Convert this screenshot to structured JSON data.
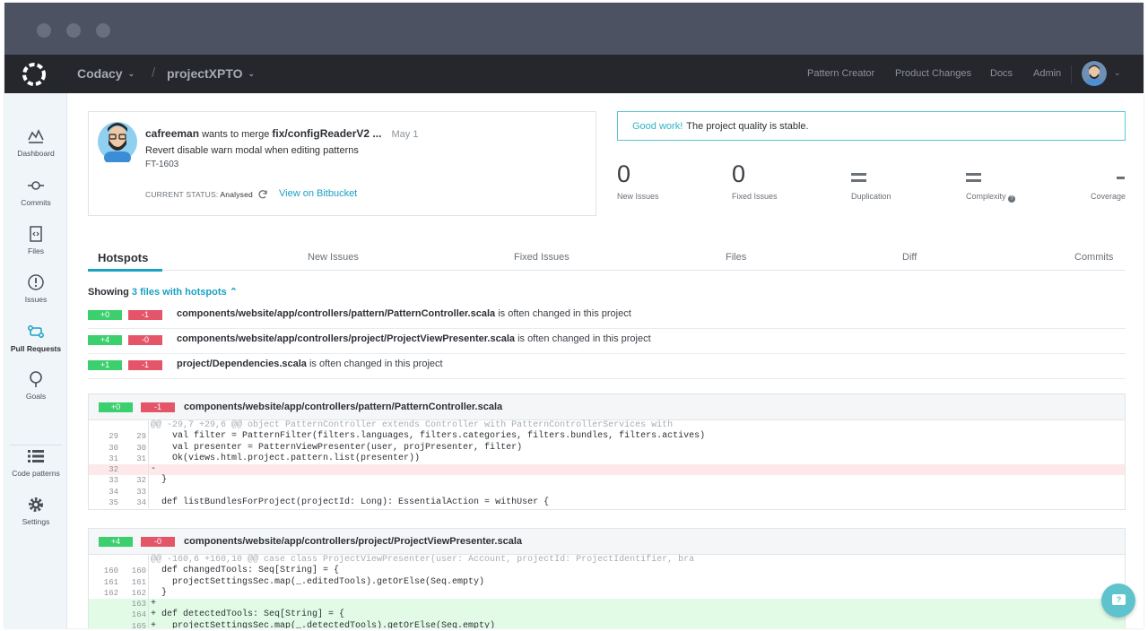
{
  "nav": {
    "org": "Codacy",
    "project": "projectXPTO",
    "links": [
      "Pattern Creator",
      "Product Changes",
      "Docs",
      "Admin"
    ]
  },
  "sidebar": {
    "items": [
      {
        "label": "Dashboard",
        "icon": "dashboard-icon"
      },
      {
        "label": "Commits",
        "icon": "commit-icon"
      },
      {
        "label": "Files",
        "icon": "file-icon"
      },
      {
        "label": "Issues",
        "icon": "alert-icon"
      },
      {
        "label": "Pull Requests",
        "icon": "pull-request-icon"
      },
      {
        "label": "Goals",
        "icon": "goals-icon"
      },
      {
        "label": "Code patterns",
        "icon": "list-icon"
      },
      {
        "label": "Settings",
        "icon": "gear-icon"
      }
    ]
  },
  "pr": {
    "author": "cafreeman",
    "action": "wants to merge",
    "branch": "fix/configReaderV2 ...",
    "date": "May 1",
    "title": "Revert disable warn modal when editing patterns",
    "code": "FT-1603",
    "status_label": "CURRENT STATUS:",
    "status_value": "Analysed",
    "link": "View on Bitbucket"
  },
  "quality": {
    "good": "Good work!",
    "message": "The project quality is stable."
  },
  "metrics": [
    {
      "value": "0",
      "label": "New Issues"
    },
    {
      "value": "0",
      "label": "Fixed Issues"
    },
    {
      "value": "=",
      "label": "Duplication"
    },
    {
      "value": "=",
      "label": "Complexity"
    },
    {
      "value": "-",
      "label": "Coverage"
    }
  ],
  "tabs": [
    "Hotspots",
    "New Issues",
    "Fixed Issues",
    "Files",
    "Diff",
    "Commits"
  ],
  "showing": {
    "prefix": "Showing",
    "link": "3 files with hotspots"
  },
  "hotspots": [
    {
      "add": "+0",
      "del": "-1",
      "file": "components/website/app/controllers/pattern/PatternController.scala",
      "suffix": "is often changed in this project"
    },
    {
      "add": "+4",
      "del": "-0",
      "file": "components/website/app/controllers/project/ProjectViewPresenter.scala",
      "suffix": "is often changed in this project"
    },
    {
      "add": "+1",
      "del": "-1",
      "file": "project/Dependencies.scala",
      "suffix": "is often changed in this project"
    }
  ],
  "diffs": [
    {
      "add": "+0",
      "del": "-1",
      "file": "components/website/app/controllers/pattern/PatternController.scala",
      "lines": [
        {
          "a": "",
          "b": "",
          "type": "hunk",
          "code": "@@ -29,7 +29,6 @@ object PatternController extends Controller with PatternControllerServices with"
        },
        {
          "a": "29",
          "b": "29",
          "type": "ctx",
          "code": "    val filter = PatternFilter(filters.languages, filters.categories, filters.bundles, filters.actives)"
        },
        {
          "a": "30",
          "b": "30",
          "type": "ctx",
          "code": "    val presenter = PatternViewPresenter(user, projPresenter, filter)"
        },
        {
          "a": "31",
          "b": "31",
          "type": "ctx",
          "code": "    Ok(views.html.project.pattern.list(presenter))"
        },
        {
          "a": "32",
          "b": "",
          "type": "del",
          "code": "-"
        },
        {
          "a": "33",
          "b": "32",
          "type": "ctx",
          "code": "  }"
        },
        {
          "a": "34",
          "b": "33",
          "type": "ctx",
          "code": ""
        },
        {
          "a": "35",
          "b": "34",
          "type": "ctx",
          "code": "  def listBundlesForProject(projectId: Long): EssentialAction = withUser {"
        }
      ]
    },
    {
      "add": "+4",
      "del": "-0",
      "file": "components/website/app/controllers/project/ProjectViewPresenter.scala",
      "lines": [
        {
          "a": "",
          "b": "",
          "type": "hunk",
          "code": "@@ -160,6 +160,10 @@ case class ProjectViewPresenter(user: Account, projectId: ProjectIdentifier, bra"
        },
        {
          "a": "160",
          "b": "160",
          "type": "ctx",
          "code": "  def changedTools: Seq[String] = {"
        },
        {
          "a": "161",
          "b": "161",
          "type": "ctx",
          "code": "    projectSettingsSec.map(_.editedTools).getOrElse(Seq.empty)"
        },
        {
          "a": "162",
          "b": "162",
          "type": "ctx",
          "code": "  }"
        },
        {
          "a": "",
          "b": "163",
          "type": "add",
          "code": "+"
        },
        {
          "a": "",
          "b": "164",
          "type": "add",
          "code": "+ def detectedTools: Seq[String] = {"
        },
        {
          "a": "",
          "b": "165",
          "type": "add",
          "code": "+   projectSettingsSec.map(_.detectedTools).getOrElse(Seq.empty)"
        }
      ]
    }
  ],
  "help_icon": "chat-help-icon"
}
